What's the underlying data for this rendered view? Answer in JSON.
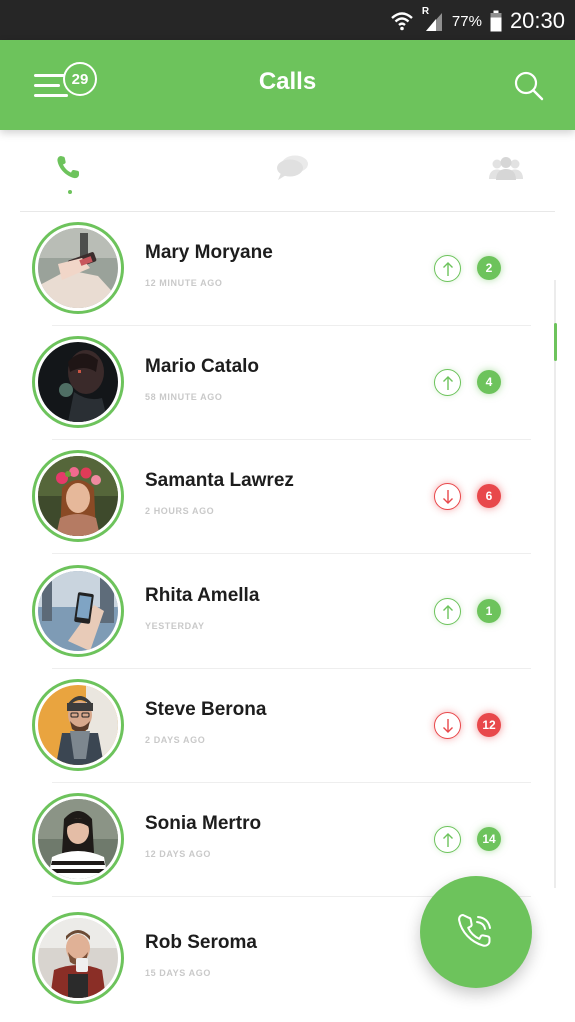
{
  "status_bar": {
    "signal_letter": "R",
    "battery_percent": "77%",
    "time": "20:30"
  },
  "app_bar": {
    "title": "Calls",
    "menu_badge": "29"
  },
  "tabs": [
    {
      "name": "calls",
      "icon": "phone-icon",
      "active": true
    },
    {
      "name": "messages",
      "icon": "chat-bubbles-icon",
      "active": false
    },
    {
      "name": "contacts",
      "icon": "group-icon",
      "active": false
    }
  ],
  "contacts": [
    {
      "name": "Mary Moryane",
      "time": "12 MINUTE AGO",
      "direction": "outgoing",
      "count": "2"
    },
    {
      "name": "Mario Catalo",
      "time": "58 MINUTE AGO",
      "direction": "outgoing",
      "count": "4"
    },
    {
      "name": "Samanta Lawrez",
      "time": "2 HOURS AGO",
      "direction": "missed",
      "count": "6"
    },
    {
      "name": "Rhita Amella",
      "time": "YESTERDAY",
      "direction": "outgoing",
      "count": "1"
    },
    {
      "name": "Steve Berona",
      "time": "2 DAYS AGO",
      "direction": "missed",
      "count": "12"
    },
    {
      "name": "Sonia Mertro",
      "time": "12 DAYS AGO",
      "direction": "outgoing",
      "count": "14"
    },
    {
      "name": "Rob Seroma",
      "time": "15 DAYS AGO",
      "direction": "outgoing",
      "count": ""
    }
  ],
  "colors": {
    "accent": "#6dc35c",
    "missed": "#e8484b",
    "status_bar": "#262626"
  },
  "fab": {
    "icon": "phone-call-icon"
  }
}
